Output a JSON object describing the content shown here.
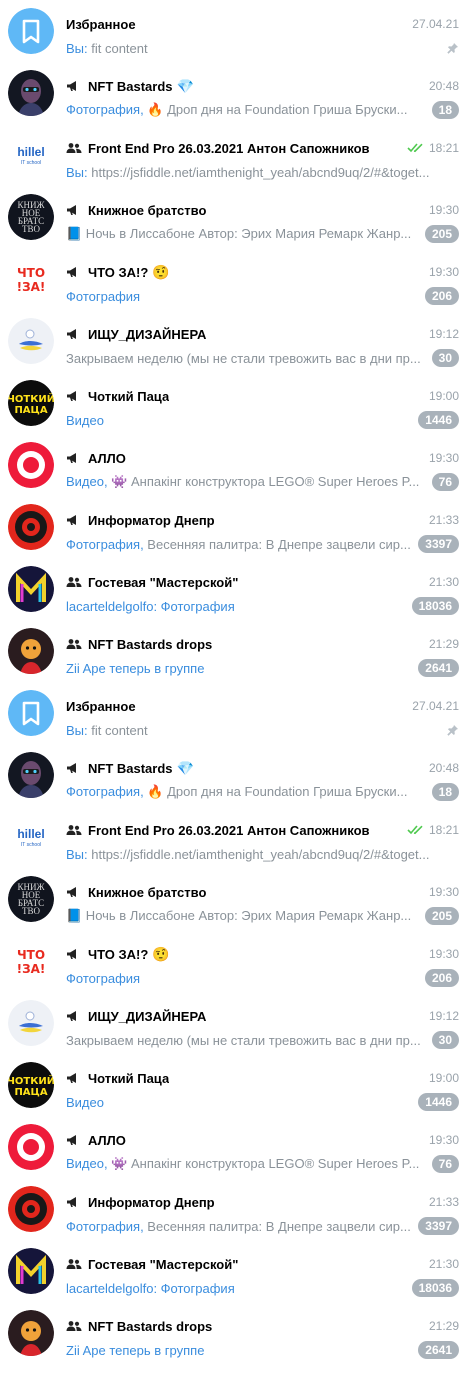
{
  "colors": {
    "accent": "#3a8dde",
    "badge_muted": "#a9b2ba",
    "saved_avatar": "#5fb8f6",
    "check": "#4fc94f"
  },
  "chats": [
    {
      "avatar": "saved",
      "type": "none",
      "title": "Избранное",
      "time": "27.04.21",
      "pre_media": "Вы: ",
      "pre_text": "fit content",
      "badge": "",
      "pinned": true,
      "check": false
    },
    {
      "avatar": "nft-bastards",
      "type": "channel",
      "title": "NFT Bastards",
      "title_emoji": "💎",
      "time": "20:48",
      "pre_media": "Фотография, ",
      "pre_emoji": "🔥",
      "pre_text": " Дроп дня на Foundation  Гриша Бруски...",
      "badge": "18"
    },
    {
      "avatar": "hillel",
      "type": "group",
      "title": "Front End Pro 26.03.2021 Антон Сапожников",
      "time": "18:21",
      "check": true,
      "pre_media": "Вы: ",
      "pre_text": "https://jsfiddle.net/iamthenight_yeah/abcnd9uq/2/#&toget...",
      "badge": ""
    },
    {
      "avatar": "book-brotherhood",
      "type": "channel",
      "title": "Книжное братство",
      "time": "19:30",
      "pre_emoji": "📘",
      "pre_text": " Ночь в Лиссабоне Автор: Эрих Мария Ремарк Жанр...",
      "badge": "205"
    },
    {
      "avatar": "chto-za",
      "type": "channel",
      "title": "ЧТО ЗА!?",
      "title_emoji": "🤨",
      "time": "19:30",
      "pre_media": "Фотография",
      "badge": "206"
    },
    {
      "avatar": "ishchu-designera",
      "type": "channel",
      "title": "ИЩУ_ДИЗАЙНЕРА",
      "time": "19:12",
      "pre_text": "Закрываем неделю (мы не стали тревожить вас в дни пр...",
      "badge": "30"
    },
    {
      "avatar": "chotkiy-patsa",
      "type": "channel",
      "title": "Чоткий Паца",
      "time": "19:00",
      "pre_media": "Видео",
      "badge": "1446"
    },
    {
      "avatar": "allo",
      "type": "channel",
      "title": "АЛЛО",
      "time": "19:30",
      "pre_media": "Видео, ",
      "pre_emoji": "👾",
      "pre_text": " Анпакінг конструктора LEGO® Super Heroes P...",
      "badge": "76"
    },
    {
      "avatar": "informator",
      "type": "channel",
      "title": "Информатор Днепр",
      "time": "21:33",
      "pre_media": "Фотография, ",
      "pre_text": "Весенняя палитра: В Днепре зацвели сир...",
      "badge": "3397"
    },
    {
      "avatar": "gostevaya",
      "type": "group",
      "title": "Гостевая \"Мастерской\"",
      "time": "21:30",
      "pre_media": "lacarteldelgolfo: Фотография",
      "badge": "18036"
    },
    {
      "avatar": "nft-drops",
      "type": "group",
      "title": "NFT Bastards drops",
      "time": "21:29",
      "pre_media": "Zii Ape теперь в группе",
      "badge": "2641"
    },
    {
      "avatar": "saved",
      "type": "none",
      "title": "Избранное",
      "time": "27.04.21",
      "pre_media": "Вы: ",
      "pre_text": "fit content",
      "badge": "",
      "pinned": true,
      "check": false
    },
    {
      "avatar": "nft-bastards",
      "type": "channel",
      "title": "NFT Bastards",
      "title_emoji": "💎",
      "time": "20:48",
      "pre_media": "Фотография, ",
      "pre_emoji": "🔥",
      "pre_text": " Дроп дня на Foundation  Гриша Бруски...",
      "badge": "18"
    },
    {
      "avatar": "hillel",
      "type": "group",
      "title": "Front End Pro 26.03.2021 Антон Сапожников",
      "time": "18:21",
      "check": true,
      "pre_media": "Вы: ",
      "pre_text": "https://jsfiddle.net/iamthenight_yeah/abcnd9uq/2/#&toget...",
      "badge": ""
    },
    {
      "avatar": "book-brotherhood",
      "type": "channel",
      "title": "Книжное братство",
      "time": "19:30",
      "pre_emoji": "📘",
      "pre_text": " Ночь в Лиссабоне Автор: Эрих Мария Ремарк Жанр...",
      "badge": "205"
    },
    {
      "avatar": "chto-za",
      "type": "channel",
      "title": "ЧТО ЗА!?",
      "title_emoji": "🤨",
      "time": "19:30",
      "pre_media": "Фотография",
      "badge": "206"
    },
    {
      "avatar": "ishchu-designera",
      "type": "channel",
      "title": "ИЩУ_ДИЗАЙНЕРА",
      "time": "19:12",
      "pre_text": "Закрываем неделю (мы не стали тревожить вас в дни пр...",
      "badge": "30"
    },
    {
      "avatar": "chotkiy-patsa",
      "type": "channel",
      "title": "Чоткий Паца",
      "time": "19:00",
      "pre_media": "Видео",
      "badge": "1446"
    },
    {
      "avatar": "allo",
      "type": "channel",
      "title": "АЛЛО",
      "time": "19:30",
      "pre_media": "Видео, ",
      "pre_emoji": "👾",
      "pre_text": " Анпакінг конструктора LEGO® Super Heroes P...",
      "badge": "76"
    },
    {
      "avatar": "informator",
      "type": "channel",
      "title": "Информатор Днепр",
      "time": "21:33",
      "pre_media": "Фотография, ",
      "pre_text": "Весенняя палитра: В Днепре зацвели сир...",
      "badge": "3397"
    },
    {
      "avatar": "gostevaya",
      "type": "group",
      "title": "Гостевая \"Мастерской\"",
      "time": "21:30",
      "pre_media": "lacarteldelgolfo: Фотография",
      "badge": "18036"
    },
    {
      "avatar": "nft-drops",
      "type": "group",
      "title": "NFT Bastards drops",
      "time": "21:29",
      "pre_media": "Zii Ape теперь в группе",
      "badge": "2641"
    }
  ]
}
